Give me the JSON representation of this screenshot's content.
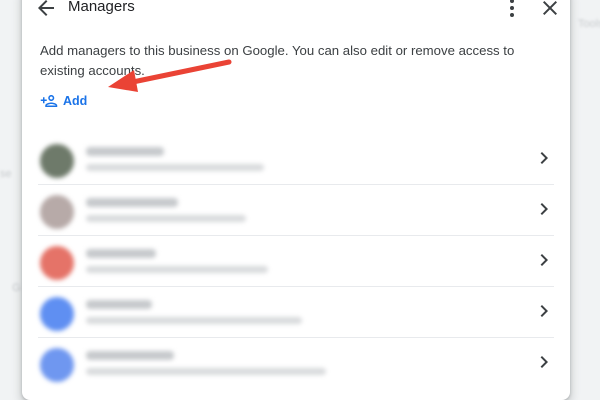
{
  "dialog": {
    "title": "Managers",
    "description": "Add managers to this business on Google. You can also edit or remove access to existing accounts.",
    "add_label": "Add",
    "icons": {
      "back": "arrow-back-icon",
      "more": "more-vert-icon",
      "close": "close-icon",
      "add": "person-add-icon",
      "row": "chevron-right-icon"
    }
  },
  "managers": [
    {
      "avatar_color": "#6e7a6a"
    },
    {
      "avatar_color": "#b7aaa8"
    },
    {
      "avatar_color": "#e57368"
    },
    {
      "avatar_color": "#5f8ff2"
    },
    {
      "avatar_color": "#6f97f0"
    }
  ],
  "colors": {
    "accent": "#1a73e8",
    "arrow": "#ea4335"
  }
}
